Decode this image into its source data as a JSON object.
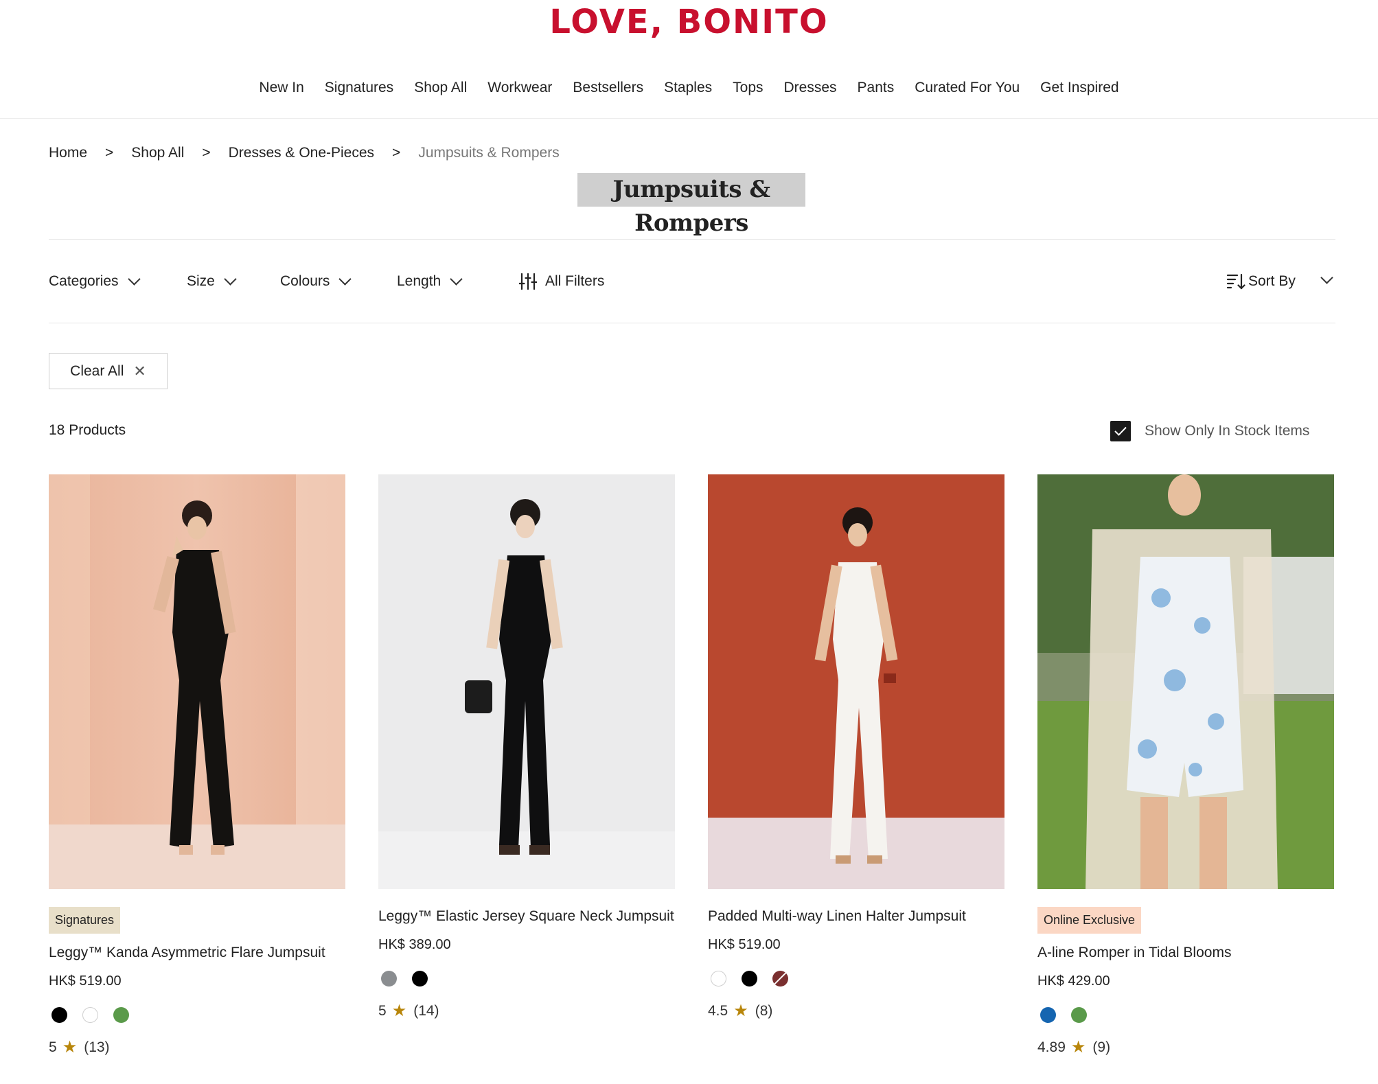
{
  "brand": {
    "logo_text": "LOVE, BONITO",
    "color": "#c8102e"
  },
  "nav": {
    "items": [
      "New In",
      "Signatures",
      "Shop All",
      "Workwear",
      "Bestsellers",
      "Staples",
      "Tops",
      "Dresses",
      "Pants",
      "Curated For You",
      "Get Inspired"
    ]
  },
  "breadcrumb": {
    "items": [
      "Home",
      "Shop All",
      "Dresses & One-Pieces",
      "Jumpsuits & Rompers"
    ],
    "separator": ">"
  },
  "page": {
    "title": "Jumpsuits & Rompers"
  },
  "filters": {
    "categories": "Categories",
    "size": "Size",
    "colours": "Colours",
    "length": "Length",
    "all_filters": "All Filters",
    "sort_by": "Sort By"
  },
  "clear_all": "Clear All",
  "results": {
    "count_text": "18 Products",
    "stock_toggle_label": "Show Only In Stock Items",
    "stock_toggle_checked": true
  },
  "products": [
    {
      "badge": "Signatures",
      "name": "Leggy™ Kanda Asymmetric Flare Jumpsuit",
      "price": "HK$ 519.00",
      "swatches": [
        "#000000",
        "#ffffff",
        "#5a9a4a"
      ],
      "rating": "5",
      "reviews": "(13)"
    },
    {
      "badge": "",
      "name": "Leggy™ Elastic Jersey Square Neck Jumpsuit",
      "price": "HK$ 389.00",
      "swatches": [
        "#8a8d90",
        "#000000"
      ],
      "rating": "5",
      "reviews": "(14)"
    },
    {
      "badge": "",
      "name": "Padded Multi-way Linen Halter Jumpsuit",
      "price": "HK$ 519.00",
      "swatches": [
        "#ffffff",
        "#000000",
        "#7a2f2f"
      ],
      "rating": "4.5",
      "reviews": "(8)"
    },
    {
      "badge": "Online Exclusive",
      "name": "A-line Romper in Tidal Blooms",
      "price": "HK$ 429.00",
      "swatches": [
        "#1565b0",
        "#5a9a4a"
      ],
      "rating": "4.89",
      "reviews": "(9)"
    }
  ]
}
